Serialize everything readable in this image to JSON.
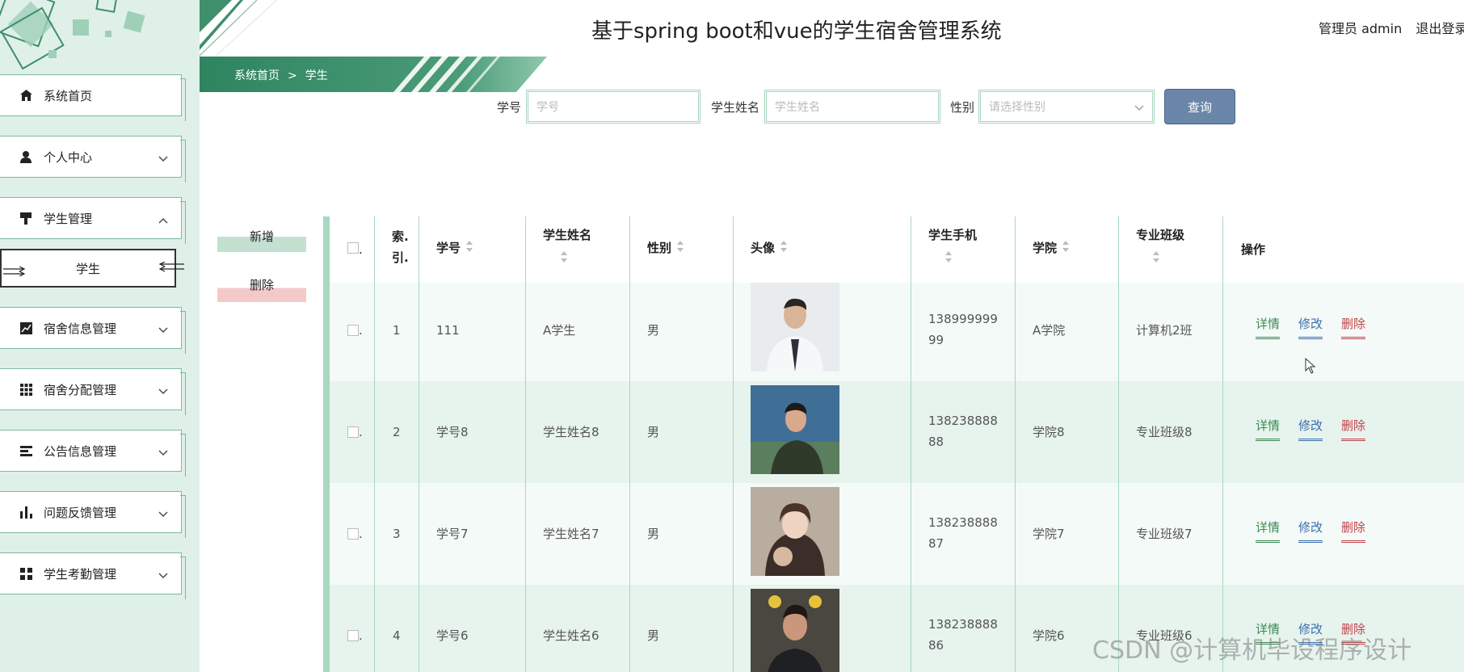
{
  "header": {
    "title": "基于spring boot和vue的学生宿舍管理系统",
    "user": "管理员 admin",
    "logout": "退出登录"
  },
  "breadcrumb": {
    "home": "系统首页",
    "sep": ">",
    "current": "学生"
  },
  "sidebar": {
    "items": [
      {
        "label": "系统首页",
        "icon": "home-icon"
      },
      {
        "label": "个人中心",
        "icon": "user-icon"
      },
      {
        "label": "学生管理",
        "icon": "brush-icon"
      },
      {
        "label": "学生"
      },
      {
        "label": "宿舍信息管理",
        "icon": "line-chart-icon"
      },
      {
        "label": "宿舍分配管理",
        "icon": "grid-icon"
      },
      {
        "label": "公告信息管理",
        "icon": "list-icon"
      },
      {
        "label": "问题反馈管理",
        "icon": "bar-chart-icon"
      },
      {
        "label": "学生考勤管理",
        "icon": "apps-icon"
      }
    ]
  },
  "search": {
    "id_label": "学号",
    "id_placeholder": "学号",
    "name_label": "学生姓名",
    "name_placeholder": "学生姓名",
    "gender_label": "性别",
    "gender_placeholder": "请选择性别",
    "query": "查询"
  },
  "actions": {
    "add": "新增",
    "delete": "删除"
  },
  "table": {
    "headers": {
      "check": ".",
      "index_1": "索.",
      "index_2": "引.",
      "student_id": "学号",
      "name": "学生姓名",
      "gender": "性别",
      "avatar": "头像",
      "phone": "学生手机",
      "college": "学院",
      "class": "专业班级",
      "ops": "操作"
    },
    "rows": [
      {
        "check": ".",
        "index": "1",
        "student_id": "111",
        "name": "A学生",
        "gender": "男",
        "phone_1": "138999999",
        "phone_2": "99",
        "college": "A学院",
        "class": "计算机2班"
      },
      {
        "check": ".",
        "index": "2",
        "student_id": "学号8",
        "name": "学生姓名8",
        "gender": "男",
        "phone_1": "138238888",
        "phone_2": "88",
        "college": "学院8",
        "class": "专业班级8"
      },
      {
        "check": ".",
        "index": "3",
        "student_id": "学号7",
        "name": "学生姓名7",
        "gender": "男",
        "phone_1": "138238888",
        "phone_2": "87",
        "college": "学院7",
        "class": "专业班级7"
      },
      {
        "check": ".",
        "index": "4",
        "student_id": "学号6",
        "name": "学生姓名6",
        "gender": "男",
        "phone_1": "138238888",
        "phone_2": "86",
        "college": "学院6",
        "class": "专业班级6"
      }
    ],
    "ops": {
      "detail": "详情",
      "edit": "修改",
      "remove": "删除"
    }
  },
  "watermark": "CSDN @计算机毕设程序设计",
  "colors": {
    "accent_green": "#3e8f6a",
    "query_button": "#6a86a8",
    "delete_red": "#c0434b",
    "edit_blue": "#3a6fb0"
  }
}
